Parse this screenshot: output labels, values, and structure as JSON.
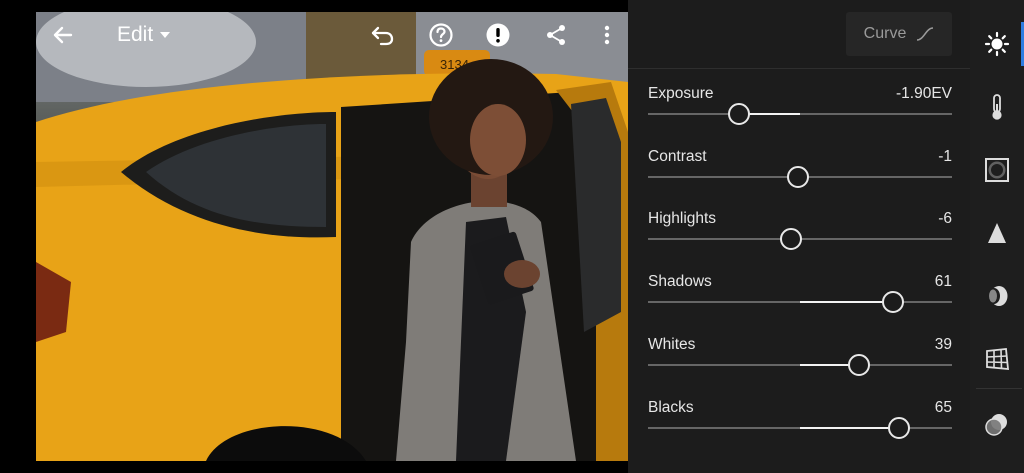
{
  "header": {
    "edit_label": "Edit"
  },
  "photo": {
    "taxi_sign_text": "3134"
  },
  "panel": {
    "curve_label": "Curve",
    "sliders": [
      {
        "label": "Exposure",
        "value": "-1.90EV",
        "position": 0.3,
        "center": 0.5
      },
      {
        "label": "Contrast",
        "value": "-1",
        "position": 0.495,
        "center": 0.5
      },
      {
        "label": "Highlights",
        "value": "-6",
        "position": 0.47,
        "center": 0.5
      },
      {
        "label": "Shadows",
        "value": "61",
        "position": 0.805,
        "center": 0.5
      },
      {
        "label": "Whites",
        "value": "39",
        "position": 0.695,
        "center": 0.5
      },
      {
        "label": "Blacks",
        "value": "65",
        "position": 0.825,
        "center": 0.5
      }
    ]
  },
  "rail": {
    "items": [
      {
        "icon": "light-icon",
        "active": true
      },
      {
        "icon": "color-temperature-icon",
        "active": false
      },
      {
        "icon": "effects-vignette-icon",
        "active": false
      },
      {
        "icon": "detail-sharpen-icon",
        "active": false
      },
      {
        "icon": "optics-icon",
        "active": false
      },
      {
        "icon": "geometry-icon",
        "active": false
      },
      {
        "icon": "presets-icon",
        "active": false
      }
    ]
  },
  "colors": {
    "accent": "#2e7de1",
    "panel_bg": "#1c1c1c",
    "taxi_yellow": "#e8a317"
  }
}
